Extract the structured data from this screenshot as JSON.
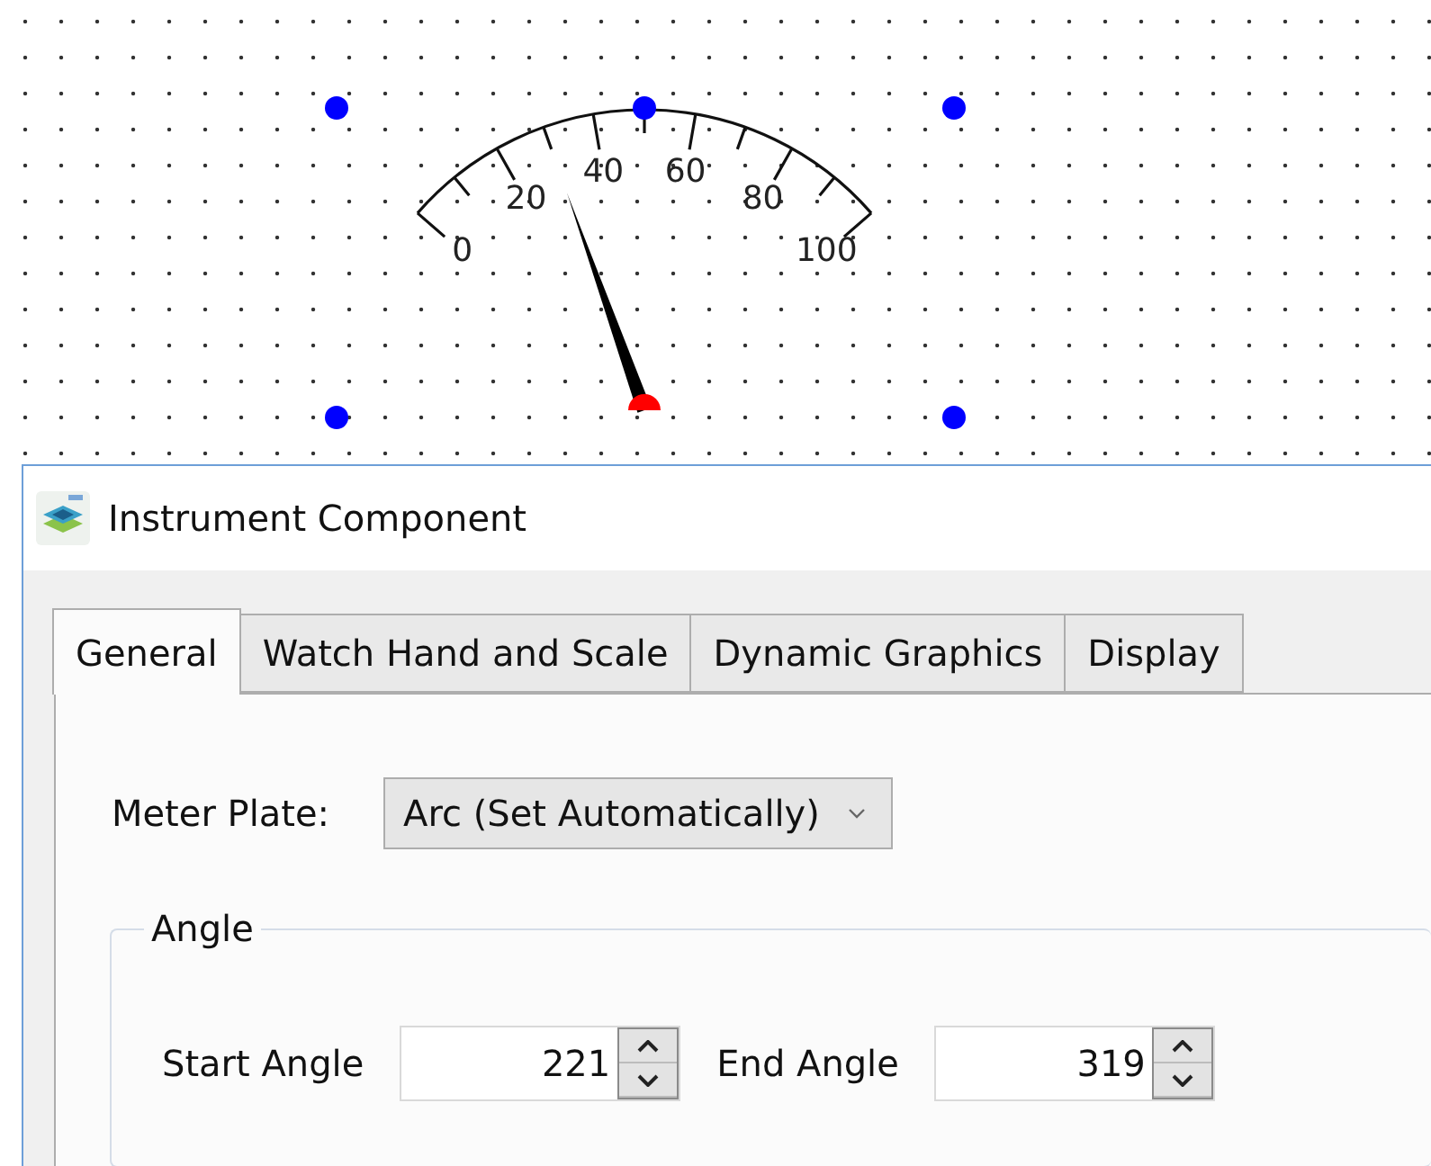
{
  "canvas": {
    "gauge": {
      "selected": true,
      "scale_labels": [
        "0",
        "20",
        "40",
        "60",
        "80",
        "100"
      ]
    }
  },
  "dialog": {
    "title": "Instrument Component",
    "tabs": [
      {
        "label": "General",
        "selected": true
      },
      {
        "label": "Watch Hand and Scale",
        "selected": false
      },
      {
        "label": "Dynamic Graphics",
        "selected": false
      },
      {
        "label": "Display",
        "selected": false
      }
    ],
    "meter_plate": {
      "label": "Meter Plate:",
      "value": "Arc (Set Automatically)"
    },
    "angle": {
      "title": "Angle",
      "fields": [
        {
          "label": "Start Angle",
          "value": "221"
        },
        {
          "label": "End Angle",
          "value": "319"
        }
      ]
    }
  }
}
